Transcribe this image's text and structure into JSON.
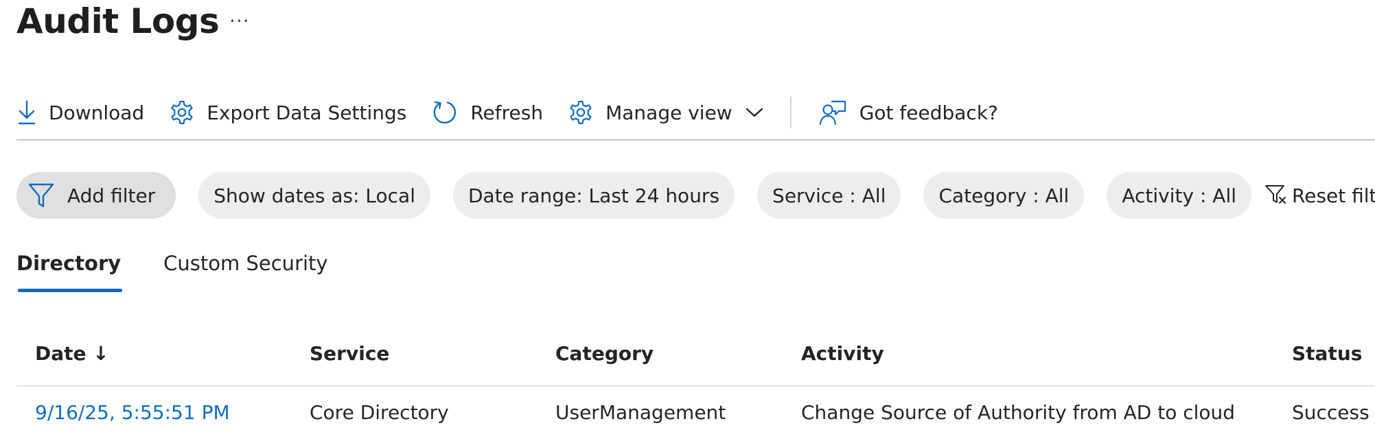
{
  "page": {
    "title": "Audit Logs",
    "more_label": "···"
  },
  "toolbar": {
    "download": "Download",
    "export_settings": "Export Data Settings",
    "refresh": "Refresh",
    "manage_view": "Manage view",
    "feedback": "Got feedback?"
  },
  "filters": {
    "add": "Add filter",
    "pills": [
      "Show dates as: Local",
      "Date range: Last 24 hours",
      "Service : All",
      "Category : All",
      "Activity : All"
    ],
    "reset": "Reset filters"
  },
  "tabs": [
    {
      "label": "Directory",
      "active": true
    },
    {
      "label": "Custom Security",
      "active": false
    }
  ],
  "table": {
    "columns": [
      "Date ↓",
      "Service",
      "Category",
      "Activity",
      "Status"
    ],
    "rows": [
      {
        "date": "9/16/25, 5:55:51 PM",
        "service": "Core Directory",
        "category": "UserManagement",
        "activity": "Change Source of Authority from AD to cloud",
        "status": "Success"
      }
    ]
  },
  "colors": {
    "accent": "#0f6cbd",
    "pill_bg": "#ededed",
    "add_filter_bg": "#e0e0e0",
    "text": "#242424"
  },
  "icons": {
    "download": "download-icon",
    "export_settings": "gear-icon",
    "refresh": "refresh-icon",
    "manage_view": "gear-icon",
    "manage_view_caret": "chevron-down-icon",
    "feedback": "feedback-icon",
    "add_filter": "filter-icon",
    "reset": "filter-clear-icon"
  }
}
